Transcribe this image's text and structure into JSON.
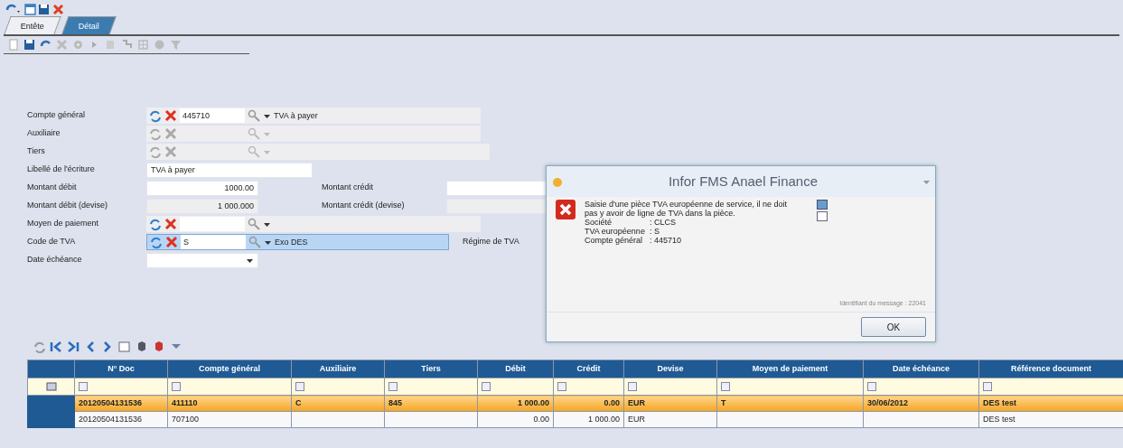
{
  "tabs": [
    {
      "label": "Entête",
      "selected": false
    },
    {
      "label": "Détail",
      "selected": true
    }
  ],
  "form": {
    "rows": [
      {
        "kind": "lookup",
        "label": "Compte général",
        "code": "445710",
        "description": "TVA à payer",
        "disabled": false,
        "focused": false
      },
      {
        "kind": "lookup",
        "label": "Auxiliaire",
        "disabled": true,
        "focused": false
      },
      {
        "kind": "lookup",
        "label": "Tiers",
        "disabled": true,
        "focused": false
      },
      {
        "kind": "text",
        "label": "Libellé de l'écriture",
        "value": "TVA à payer"
      },
      {
        "kind": "amount",
        "label": "Montant débit",
        "value": "1000.00",
        "disabled": false,
        "side_label": "Montant crédit"
      },
      {
        "kind": "amount",
        "label": "Montant débit (devise)",
        "value": "1 000.000",
        "disabled": true,
        "side_label": "Montant crédit (devise)"
      },
      {
        "kind": "lookup",
        "label": "Moyen de paiement",
        "disabled": false,
        "focused": false
      },
      {
        "kind": "lookup",
        "label": "Code de TVA",
        "code": "S",
        "description": "Exo DES",
        "disabled": false,
        "focused": true,
        "side_label": "Régime de TVA"
      },
      {
        "kind": "date",
        "label": "Date échéance"
      }
    ]
  },
  "grid": {
    "columns": [
      "N° Doc",
      "Compte général",
      "Auxiliaire",
      "Tiers",
      "Débit",
      "Crédit",
      "Devise",
      "Moyen de paiement",
      "Date échéance",
      "Référence document"
    ],
    "rows": [
      {
        "selected": true,
        "cells": [
          "20120504131536",
          "411110",
          "C",
          "845",
          "1 000.00",
          "0.00",
          "EUR",
          "T",
          "30/06/2012",
          "DES test"
        ]
      },
      {
        "selected": false,
        "cells": [
          "20120504131536",
          "707100",
          "",
          "",
          "0.00",
          "1 000.00",
          "EUR",
          "",
          "",
          "DES test"
        ]
      }
    ]
  },
  "dialog": {
    "title": "Infor FMS Anael Finance",
    "message": "Saisie d'une pièce TVA européenne de service, il ne doit pas y avoir de ligne de TVA  dans la pièce.",
    "details": [
      {
        "label": "Société",
        "value": ": CLCS"
      },
      {
        "label": "TVA européenne",
        "value": ": S"
      },
      {
        "label": "Compte général",
        "value": ": 445710"
      }
    ],
    "identifier": "Identifiant du message : 22041",
    "button": "OK"
  }
}
